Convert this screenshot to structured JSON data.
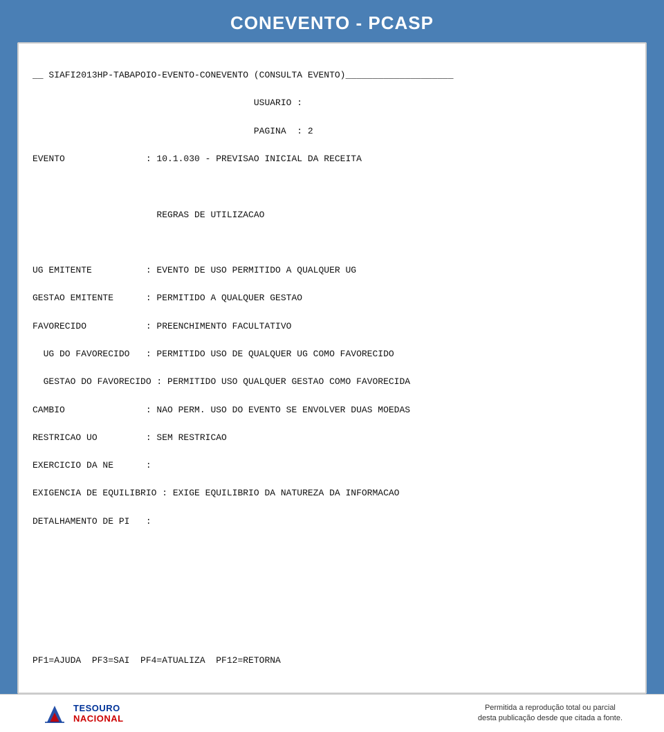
{
  "header": {
    "title": "CONEVENTO - PCASP"
  },
  "content": {
    "line1": "__ SIAFI2013HP-TABAPOIO-EVENTO-CONEVENTO (CONSULTA EVENTO)____________________",
    "line2": "                                         USUARIO :",
    "line3": "                                         PAGINA  : 2",
    "line4": "EVENTO               : 10.1.030 - PREVISAO INICIAL DA RECEITA",
    "line5": "",
    "line6": "                       REGRAS DE UTILIZACAO",
    "line7": "",
    "line8": "UG EMITENTE          : EVENTO DE USO PERMITIDO A QUALQUER UG",
    "line9": "GESTAO EMITENTE      : PERMITIDO A QUALQUER GESTAO",
    "line10": "FAVORECIDO           : PREENCHIMENTO FACULTATIVO",
    "line11": "  UG DO FAVORECIDO   : PERMITIDO USO DE QUALQUER UG COMO FAVORECIDO",
    "line12": "  GESTAO DO FAVORECIDO : PERMITIDO USO QUALQUER GESTAO COMO FAVORECIDA",
    "line13": "CAMBIO               : NAO PERM. USO DO EVENTO SE ENVOLVER DUAS MOEDAS",
    "line14": "RESTRICAO UO         : SEM RESTRICAO",
    "line15": "EXERCICIO DA NE      :",
    "line16": "EXIGENCIA DE EQUILIBRIO : EXIGE EQUILIBRIO DA NATUREZA DA INFORMACAO",
    "line17": "DETALHAMENTO DE PI   :",
    "line18": "",
    "line19": "",
    "line20": "",
    "line21": "",
    "line22": "PF1=AJUDA  PF3=SAI  PF4=ATUALIZA  PF12=RETORNA"
  },
  "footer": {
    "logo_line1": "TESOURO",
    "logo_line2": "NACIONAL",
    "copy_line1": "Permitida a reprodução total ou parcial",
    "copy_line2": "desta publicação desde que citada a fonte."
  }
}
